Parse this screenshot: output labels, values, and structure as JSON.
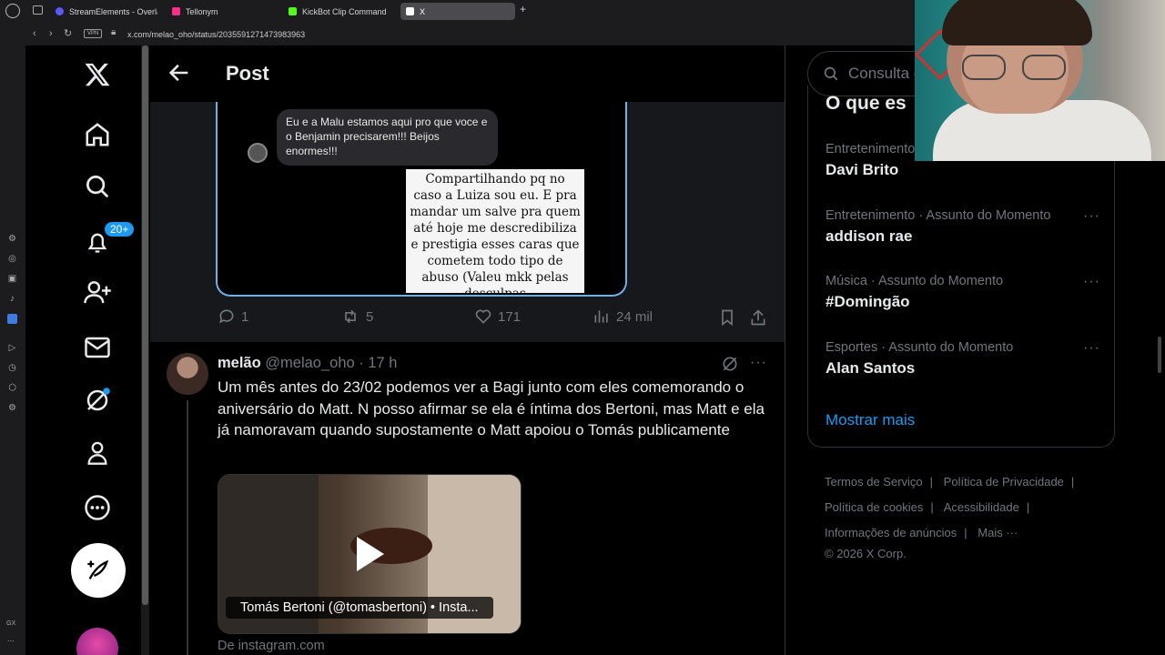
{
  "browser": {
    "tabs": [
      {
        "label": "StreamElements - Overlay",
        "color": "#5a5aff"
      },
      {
        "label": "Tellonym",
        "color": "#ff2e88"
      },
      {
        "label": "KickBot Clip Command",
        "color": "#53fc18"
      },
      {
        "label": "X",
        "color": "#ffffff"
      }
    ],
    "new_tab_icon": "plus-icon",
    "vpn_label": "VPN",
    "url": "x.com/melao_oho/status/2035591271473983963"
  },
  "opera_sidebar": {
    "footer_label": "GX",
    "more_label": "..."
  },
  "nav": {
    "notifications_badge": "20+",
    "items": [
      "x-logo",
      "home",
      "explore",
      "notifications",
      "follow",
      "messages",
      "grok",
      "profile",
      "more",
      "post"
    ]
  },
  "header": {
    "title": "Post"
  },
  "post1": {
    "chat_text": "Eu e a Malu estamos aqui pro que voce e o Benjamin precisarem!!! Beijos enormes!!!",
    "note_text": "Compartilhando pq no caso a Luiza sou eu. E pra mandar um salve pra quem até hoje me descredibiliza e prestigia esses caras que cometem todo tipo de abuso (Valeu mkk pelas desculpas",
    "stats": {
      "replies": "1",
      "reposts": "5",
      "likes": "171",
      "views": "24 mil"
    }
  },
  "post2": {
    "name": "melão",
    "handle": "@melao_oho",
    "time": "· 17 h",
    "text": "Um mês antes do 23/02 podemos ver a Bagi junto com eles comemorando o aniversário do Matt. N posso afirmar se ela é íntima dos Bertoni, mas Matt e ela já namoravam quando supostamente o Matt apoiou o Tomás publicamente",
    "video_caption": "Tomás Bertoni (@tomasbertoni) • Insta...",
    "source": "De instagram.com"
  },
  "right": {
    "search_placeholder": "Consulta o",
    "trends_title": "O que es",
    "trends": [
      {
        "category": "Entretenimento",
        "name": "Davi Brito"
      },
      {
        "category": "Entretenimento · Assunto do Momento",
        "name": "addison rae"
      },
      {
        "category": "Música · Assunto do Momento",
        "name": "#Domingão"
      },
      {
        "category": "Esportes · Assunto do Momento",
        "name": "Alan Santos"
      }
    ],
    "show_more": "Mostrar mais",
    "footer": {
      "terms": "Termos de Serviço",
      "privacy": "Política de Privacidade",
      "cookies": "Política de cookies",
      "accessibility": "Acessibilidade",
      "ads": "Informações de anúncios",
      "more": "Mais ···",
      "copyright": "© 2026 X Corp."
    }
  },
  "colors": {
    "accent": "#1d9bf0",
    "muted": "#71767b",
    "text": "#e7e9ea",
    "border": "#2f3336"
  }
}
